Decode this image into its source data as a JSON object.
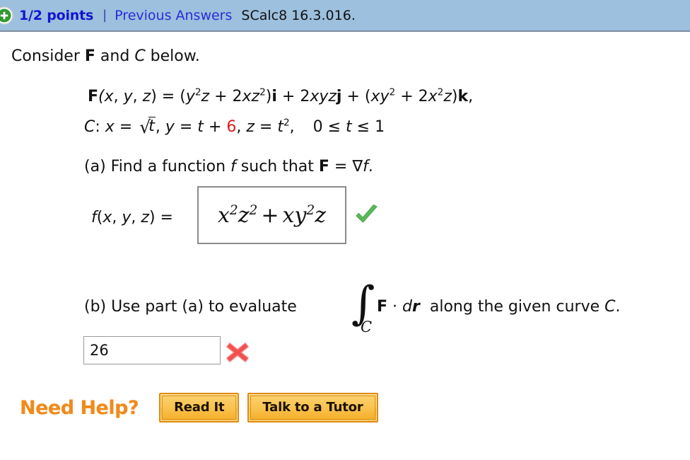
{
  "header": {
    "status_icon": "green-plus-circle-icon",
    "points": "1/2 points",
    "separator": "|",
    "previous_answers": "Previous Answers",
    "problem_id": "SCalc8 16.3.016.",
    "bar_color": "#9cc0de",
    "points_color": "#1414cf",
    "link_color": "#2b2bd8"
  },
  "question": {
    "intro_prefix": "Consider ",
    "intro_vector": "F",
    "intro_mid": " and ",
    "intro_curve": "C",
    "intro_suffix": " below.",
    "field_definition": {
      "lhs": "F(x, y, z)",
      "equals": "=",
      "term_i": "(y2z + 2xz2)i",
      "term_j": "2xyzj",
      "term_k": "(xy2 + 2x2z)k,",
      "full_text": "F(x, y, z) = (y^2 z + 2xz^2)i + 2xyz j + (xy^2 + 2x^2 z)k,"
    },
    "curve_definition": {
      "label": "C:",
      "x_eq": "x = √t,",
      "y_eq": "y = t + 6,",
      "y_highlight_value": "6",
      "y_highlight_color": "#e01b1b",
      "z_eq": "z = t2,",
      "range": "0 ≤ t ≤ 1",
      "full_text": "C: x = √t, y = t + 6, z = t^2,    0 ≤ t ≤ 1"
    }
  },
  "part_a": {
    "prompt_prefix": "(a) Find a function ",
    "prompt_f": "f",
    "prompt_mid": " such that ",
    "prompt_F": "F",
    "prompt_eq": " = ∇",
    "prompt_f2": "f",
    "prompt_end": ".",
    "answer_label": "f(x, y, z)  =",
    "answer_value_base1": "x",
    "answer_value_exp1": "2",
    "answer_value_base2": "z",
    "answer_value_exp2": "2",
    "answer_plus": "+",
    "answer_value_base3": "xy",
    "answer_value_exp3": "2",
    "answer_value_base4": "z",
    "answer_value_plain": "x^2z^2 + xy^2z",
    "status_icon": "green-check-icon",
    "status": "correct",
    "status_color": "#5cb85c"
  },
  "part_b": {
    "prompt_prefix": "(b) Use part (a) to evaluate",
    "integral_symbol": "∫",
    "integral_subscript": "C",
    "integrand_F": "F",
    "integrand_dot": "·",
    "integrand_dr": "dr",
    "prompt_suffix": "along the given curve ",
    "prompt_curve": "C",
    "prompt_period": ".",
    "answer_value": "26",
    "answer_placeholder": "",
    "status_icon": "red-cross-icon",
    "status": "incorrect",
    "status_color": "#f05050"
  },
  "need_help": {
    "label": "Need Help?",
    "label_color": "#f08a1c",
    "buttons": [
      {
        "label": "Read It",
        "name": "read-it-button"
      },
      {
        "label": "Talk to a Tutor",
        "name": "talk-to-a-tutor-button"
      }
    ]
  }
}
